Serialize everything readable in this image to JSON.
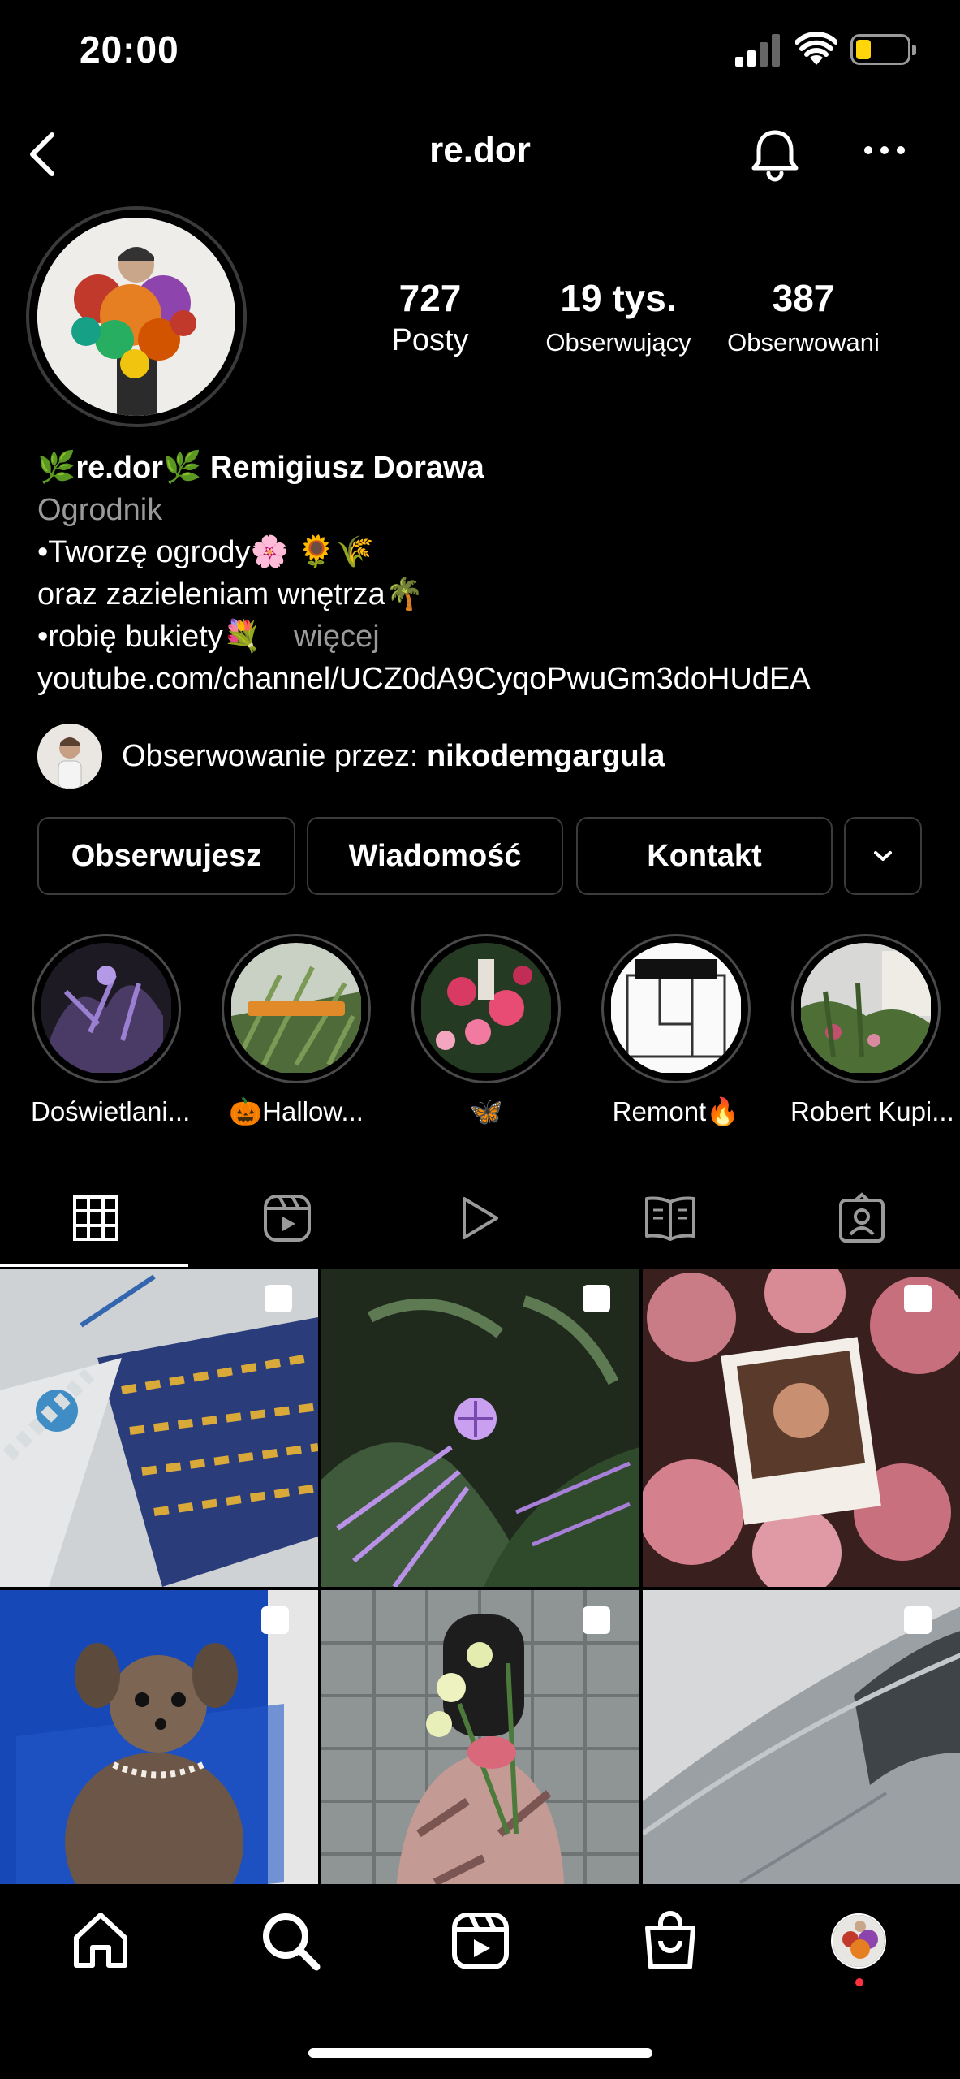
{
  "status_bar": {
    "time": "20:00"
  },
  "header": {
    "username": "re.dor"
  },
  "profile": {
    "stats": [
      {
        "value": "727",
        "label": "Posty"
      },
      {
        "value": "19 tys.",
        "label": "Obserwujący"
      },
      {
        "value": "387",
        "label": "Obserwowani"
      }
    ],
    "name_line": "🌿re.dor🌿 Remigiusz Dorawa",
    "category": "Ogrodnik",
    "bio_lines": [
      "•Tworzę ogrody🌸 🌻🌾",
      "oraz zazieleniam wnętrza🌴",
      "•robię bukiety💐"
    ],
    "more_label": "więcej",
    "link": "youtube.com/channel/UCZ0dA9CyqoPwuGm3doHUdEA",
    "followed_by_prefix": "Obserwowanie przez: ",
    "followed_by_user": "nikodemgargula"
  },
  "actions": {
    "follow_label": "Obserwujesz",
    "message_label": "Wiadomość",
    "contact_label": "Kontakt"
  },
  "highlights": [
    {
      "label": "Doświetlani..."
    },
    {
      "label": "🎃Hallow..."
    },
    {
      "label": "🦋"
    },
    {
      "label": "Remont🔥"
    },
    {
      "label": "Robert Kupi..."
    }
  ],
  "tabs": [
    "grid-icon",
    "reels-icon",
    "video-icon",
    "guides-icon",
    "tagged-icon"
  ],
  "nav": [
    "home-icon",
    "search-icon",
    "reels-icon",
    "shop-icon",
    "profile-icon"
  ],
  "colors": {
    "background": "#000000",
    "muted": "#9a9a9a",
    "notification_dot": "#ff3040"
  }
}
